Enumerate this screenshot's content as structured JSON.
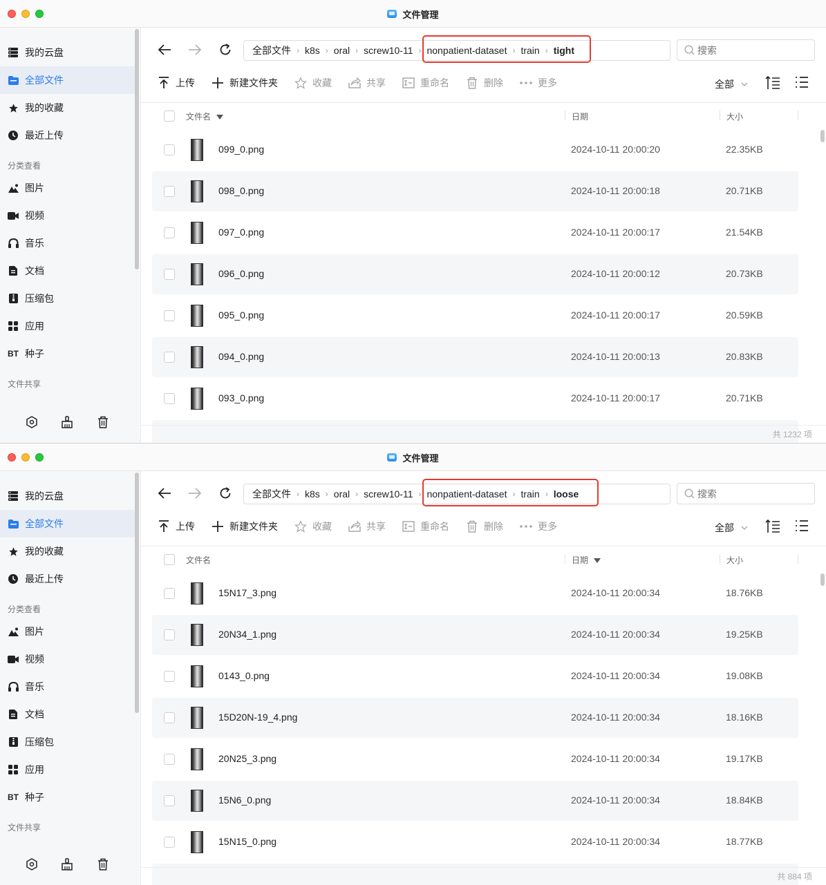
{
  "window_title": "文件管理",
  "sidebar": {
    "items": [
      {
        "label": "我的云盘",
        "icon": "drive-icon"
      },
      {
        "label": "全部文件",
        "icon": "folder-icon"
      },
      {
        "label": "我的收藏",
        "icon": "star-icon"
      },
      {
        "label": "最近上传",
        "icon": "clock-icon"
      }
    ],
    "category_title": "分类查看",
    "categories": [
      {
        "label": "图片",
        "icon": "image-icon"
      },
      {
        "label": "视频",
        "icon": "video-icon"
      },
      {
        "label": "音乐",
        "icon": "headphones-icon"
      },
      {
        "label": "文档",
        "icon": "document-icon"
      },
      {
        "label": "压缩包",
        "icon": "archive-icon"
      },
      {
        "label": "应用",
        "icon": "apps-icon"
      },
      {
        "label": "种子",
        "icon": "bt-icon",
        "prefix": "BT"
      }
    ],
    "share_title": "文件共享"
  },
  "toolbar": {
    "upload": "上传",
    "new_folder": "新建文件夹",
    "favorite": "收藏",
    "share": "共享",
    "rename": "重命名",
    "delete": "删除",
    "more": "更多",
    "filter": "全部"
  },
  "search_placeholder": "搜索",
  "columns": {
    "name": "文件名",
    "date": "日期",
    "size": "大小"
  },
  "accent_color": "#2b7de9",
  "highlight_color": "#e43b2f",
  "windows": [
    {
      "breadcrumb": [
        "全部文件",
        "k8s",
        "oral",
        "screw10-11",
        "nonpatient-dataset",
        "train",
        "tight"
      ],
      "sort_column": "name",
      "files": [
        {
          "name": "099_0.png",
          "date": "2024-10-11 20:00:20",
          "size": "22.35KB"
        },
        {
          "name": "098_0.png",
          "date": "2024-10-11 20:00:18",
          "size": "20.71KB"
        },
        {
          "name": "097_0.png",
          "date": "2024-10-11 20:00:17",
          "size": "21.54KB"
        },
        {
          "name": "096_0.png",
          "date": "2024-10-11 20:00:12",
          "size": "20.73KB"
        },
        {
          "name": "095_0.png",
          "date": "2024-10-11 20:00:17",
          "size": "20.59KB"
        },
        {
          "name": "094_0.png",
          "date": "2024-10-11 20:00:13",
          "size": "20.83KB"
        },
        {
          "name": "093_0.png",
          "date": "2024-10-11 20:00:17",
          "size": "20.71KB"
        }
      ],
      "count": "共 1232 项"
    },
    {
      "breadcrumb": [
        "全部文件",
        "k8s",
        "oral",
        "screw10-11",
        "nonpatient-dataset",
        "train",
        "loose"
      ],
      "sort_column": "date",
      "files": [
        {
          "name": "15N17_3.png",
          "date": "2024-10-11 20:00:34",
          "size": "18.76KB"
        },
        {
          "name": "20N34_1.png",
          "date": "2024-10-11 20:00:34",
          "size": "19.25KB"
        },
        {
          "name": "0143_0.png",
          "date": "2024-10-11 20:00:34",
          "size": "19.08KB"
        },
        {
          "name": "15D20N-19_4.png",
          "date": "2024-10-11 20:00:34",
          "size": "18.16KB"
        },
        {
          "name": "20N25_3.png",
          "date": "2024-10-11 20:00:34",
          "size": "19.17KB"
        },
        {
          "name": "15N6_0.png",
          "date": "2024-10-11 20:00:34",
          "size": "18.84KB"
        },
        {
          "name": "15N15_0.png",
          "date": "2024-10-11 20:00:34",
          "size": "18.77KB"
        }
      ],
      "count": "共 884 项"
    }
  ]
}
